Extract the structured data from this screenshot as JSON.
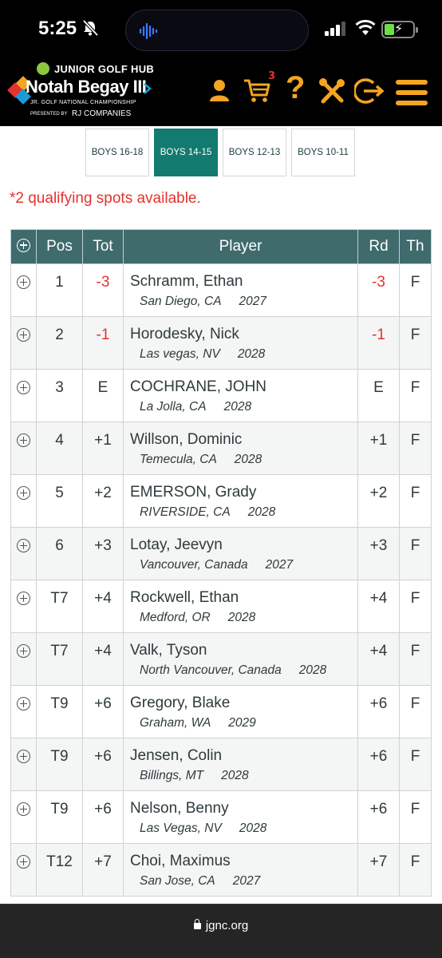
{
  "status_bar": {
    "time": "5:25"
  },
  "logo": {
    "hub": "JUNIOR GOLF HUB",
    "title": "Notah Begay III",
    "subtitle": "JR. GOLF NATIONAL CHAMPIONSHIP",
    "presented": "PRESENTED BY",
    "sponsor": "RJ COMPANIES"
  },
  "nav": {
    "icons": [
      "user-icon",
      "cart-icon",
      "help-icon",
      "tools-icon",
      "logout-icon",
      "menu-icon"
    ],
    "cart_count": "3",
    "help_glyph": "?",
    "accent": "#f4a521"
  },
  "tabs": [
    {
      "label": "BOYS 16-18"
    },
    {
      "label": "BOYS 14-15",
      "active": true
    },
    {
      "label": "BOYS 12-13"
    },
    {
      "label": "BOYS 10-11"
    }
  ],
  "notice": "*2 qualifying spots available.",
  "table": {
    "headers": {
      "pos": "Pos",
      "tot": "Tot",
      "player": "Player",
      "rd": "Rd",
      "th": "Th"
    },
    "rows": [
      {
        "pos": "1",
        "tot": "-3",
        "name": "Schramm, Ethan",
        "loc": "San Diego, CA",
        "year": "2027",
        "rd": "-3",
        "th": "F"
      },
      {
        "pos": "2",
        "tot": "-1",
        "name": "Horodesky, Nick",
        "loc": "Las vegas, NV",
        "year": "2028",
        "rd": "-1",
        "th": "F"
      },
      {
        "pos": "3",
        "tot": "E",
        "name": "COCHRANE, JOHN",
        "loc": "La Jolla, CA",
        "year": "2028",
        "rd": "E",
        "th": "F"
      },
      {
        "pos": "4",
        "tot": "+1",
        "name": "Willson, Dominic",
        "loc": "Temecula, CA",
        "year": "2028",
        "rd": "+1",
        "th": "F"
      },
      {
        "pos": "5",
        "tot": "+2",
        "name": "EMERSON, Grady",
        "loc": "RIVERSIDE, CA",
        "year": "2028",
        "rd": "+2",
        "th": "F"
      },
      {
        "pos": "6",
        "tot": "+3",
        "name": "Lotay, Jeevyn",
        "loc": "Vancouver, Canada",
        "year": "2027",
        "rd": "+3",
        "th": "F"
      },
      {
        "pos": "T7",
        "tot": "+4",
        "name": "Rockwell, Ethan",
        "loc": "Medford, OR",
        "year": "2028",
        "rd": "+4",
        "th": "F"
      },
      {
        "pos": "T7",
        "tot": "+4",
        "name": "Valk, Tyson",
        "loc": "North Vancouver, Canada",
        "year": "2028",
        "rd": "+4",
        "th": "F"
      },
      {
        "pos": "T9",
        "tot": "+6",
        "name": "Gregory, Blake",
        "loc": "Graham, WA",
        "year": "2029",
        "rd": "+6",
        "th": "F"
      },
      {
        "pos": "T9",
        "tot": "+6",
        "name": "Jensen, Colin",
        "loc": "Billings, MT",
        "year": "2028",
        "rd": "+6",
        "th": "F"
      },
      {
        "pos": "T9",
        "tot": "+6",
        "name": "Nelson, Benny",
        "loc": "Las Vegas, NV",
        "year": "2028",
        "rd": "+6",
        "th": "F"
      },
      {
        "pos": "T12",
        "tot": "+7",
        "name": "Choi, Maximus",
        "loc": "San Jose, CA",
        "year": "2027",
        "rd": "+7",
        "th": "F"
      }
    ]
  },
  "url_bar": {
    "url": "jgnc.org"
  },
  "colors": {
    "header_bg": "#000000",
    "table_header": "#3f6b6d",
    "active_tab": "#137a70",
    "under_par": "#e5322d"
  }
}
